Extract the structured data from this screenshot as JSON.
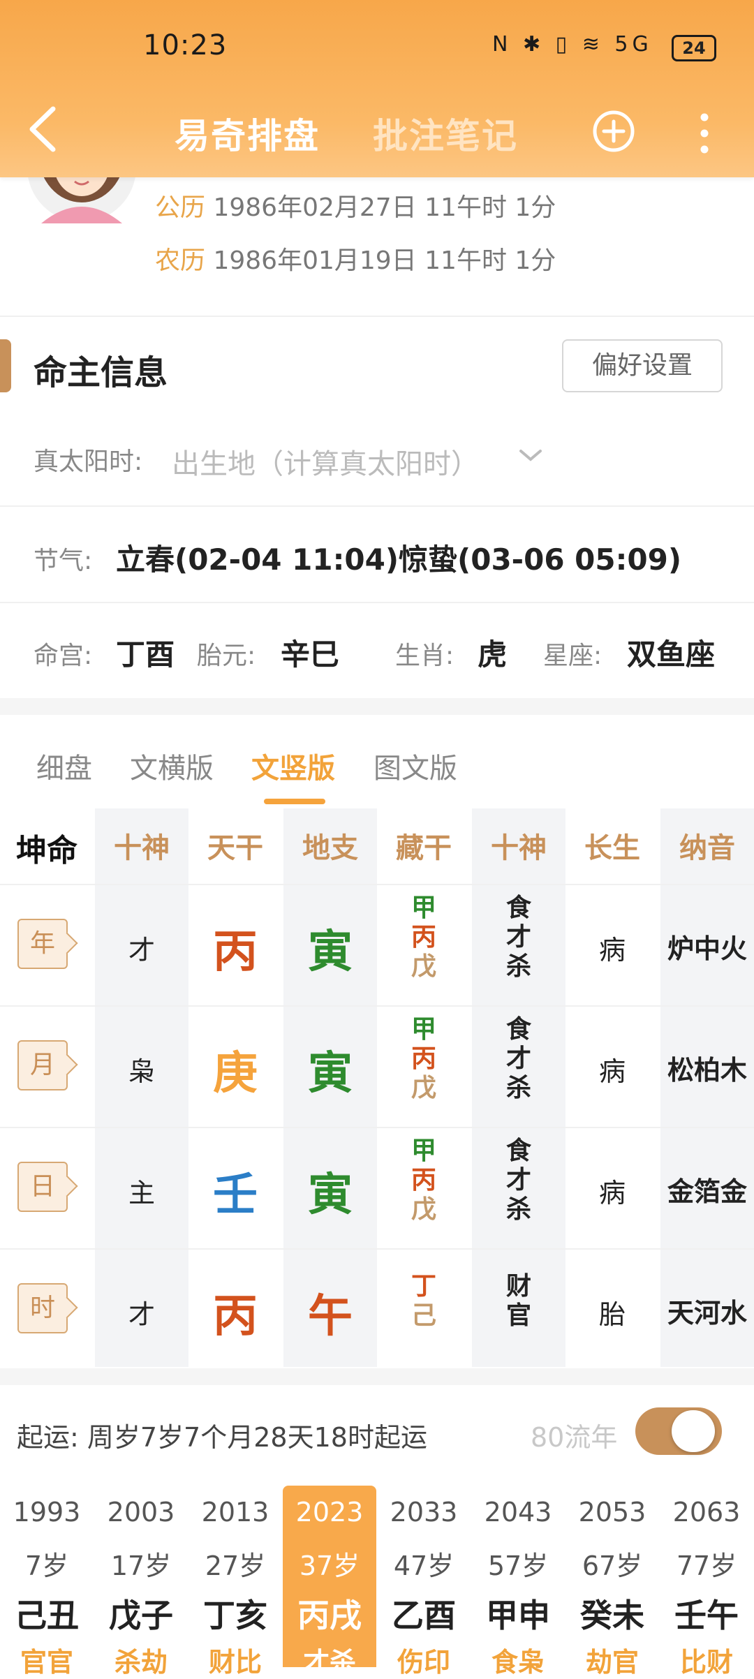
{
  "status": {
    "time": "10:23",
    "icons": "N ✱ ▯ ≋ 5G",
    "battery": "24"
  },
  "header": {
    "tab_active": "易奇排盘",
    "tab_inactive": "批注笔记"
  },
  "profile": {
    "solar_label": "公历",
    "solar_value": "1986年02月27日 11午时 1分",
    "lunar_label": "农历",
    "lunar_value": "1986年01月19日 11午时 1分"
  },
  "section": {
    "title": "命主信息",
    "pref_button": "偏好设置"
  },
  "solar_time": {
    "label": "真太阳时:",
    "placeholder": "出生地（计算真太阳时）"
  },
  "jieqi": {
    "label": "节气:",
    "value": "立春(02-04 11:04)惊蛰(03-06 05:09)"
  },
  "info": [
    {
      "label": "命宫:",
      "value": "丁酉"
    },
    {
      "label": "胎元:",
      "value": "辛巳"
    },
    {
      "label": "生肖:",
      "value": "虎"
    },
    {
      "label": "星座:",
      "value": "双鱼座"
    }
  ],
  "tabs": [
    "细盘",
    "文横版",
    "文竖版",
    "图文版"
  ],
  "active_tab_index": 2,
  "table": {
    "gender_label": "坤命",
    "headers": [
      "十神",
      "天干",
      "地支",
      "藏干",
      "十神",
      "长生",
      "纳音"
    ],
    "rows": [
      {
        "pillar": "年",
        "shishen": "才",
        "gan": "丙",
        "zhi": "寅",
        "canggan": [
          "甲",
          "丙",
          "戊"
        ],
        "cang_shishen": [
          "食",
          "才",
          "杀"
        ],
        "changsheng": "病",
        "nayin": "炉中火"
      },
      {
        "pillar": "月",
        "shishen": "枭",
        "gan": "庚",
        "zhi": "寅",
        "canggan": [
          "甲",
          "丙",
          "戊"
        ],
        "cang_shishen": [
          "食",
          "才",
          "杀"
        ],
        "changsheng": "病",
        "nayin": "松柏木"
      },
      {
        "pillar": "日",
        "shishen": "主",
        "gan": "壬",
        "zhi": "寅",
        "canggan": [
          "甲",
          "丙",
          "戊"
        ],
        "cang_shishen": [
          "食",
          "才",
          "杀"
        ],
        "changsheng": "病",
        "nayin": "金箔金"
      },
      {
        "pillar": "时",
        "shishen": "才",
        "gan": "丙",
        "zhi": "午",
        "canggan": [
          "丁",
          "己"
        ],
        "cang_shishen": [
          "财",
          "官"
        ],
        "changsheng": "胎",
        "nayin": "天河水"
      }
    ]
  },
  "colors": {
    "fire": "#d3521d",
    "metal": "#f5a33c",
    "water": "#2b7ec7",
    "wood": "#2e8b2e",
    "earth": "#c39a6b",
    "header_orange": "#f7a74a",
    "accent_brown": "#c8915a"
  },
  "qiyun": {
    "text": "起运:  周岁7岁7个月28天18时起运",
    "liunian": "80流年",
    "toggle_on": true
  },
  "dayun": [
    {
      "year": "1993",
      "age": "7岁",
      "ganzhi": "己丑",
      "shishen": "官官"
    },
    {
      "year": "2003",
      "age": "17岁",
      "ganzhi": "戊子",
      "shishen": "杀劫"
    },
    {
      "year": "2013",
      "age": "27岁",
      "ganzhi": "丁亥",
      "shishen": "财比"
    },
    {
      "year": "2023",
      "age": "37岁",
      "ganzhi": "丙戌",
      "shishen": "才杀"
    },
    {
      "year": "2033",
      "age": "47岁",
      "ganzhi": "乙酉",
      "shishen": "伤印"
    },
    {
      "year": "2043",
      "age": "57岁",
      "ganzhi": "甲申",
      "shishen": "食枭"
    },
    {
      "year": "2053",
      "age": "67岁",
      "ganzhi": "癸未",
      "shishen": "劫官"
    },
    {
      "year": "2063",
      "age": "77岁",
      "ganzhi": "壬午",
      "shishen": "比财"
    }
  ],
  "active_dayun_index": 3
}
